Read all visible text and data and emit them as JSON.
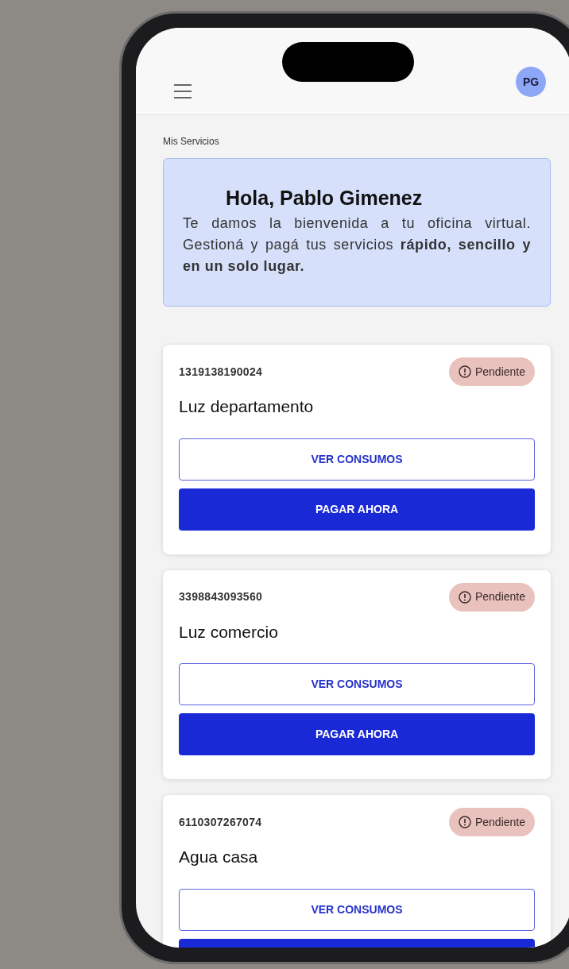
{
  "header": {
    "avatar_initials": "PG"
  },
  "section_title": "Mis Servicios",
  "welcome": {
    "title": "Hola, Pablo Gimenez",
    "text": "Te damos la bienvenida a tu oficina virtual. Gestioná y pagá tus servicios **rápido, sencillo y en un solo lugar.**"
  },
  "services": [
    {
      "number": "1319138190024",
      "name": "Luz departamento",
      "status": {
        "kind": "pending",
        "label": "Pendiente"
      },
      "buttons": [
        {
          "kind": "outline",
          "label": "VER CONSUMOS"
        },
        {
          "kind": "filled",
          "label": "PAGAR AHORA"
        }
      ]
    },
    {
      "number": "3398843093560",
      "name": "Luz comercio",
      "status": {
        "kind": "pending",
        "label": "Pendiente"
      },
      "buttons": [
        {
          "kind": "outline",
          "label": "VER CONSUMOS"
        },
        {
          "kind": "filled",
          "label": "PAGAR AHORA"
        }
      ]
    },
    {
      "number": "6110307267074",
      "name": "Agua casa",
      "status": {
        "kind": "pending",
        "label": "Pendiente"
      },
      "buttons": [
        {
          "kind": "outline",
          "label": "VER CONSUMOS"
        },
        {
          "kind": "filled"
        }
      ]
    }
  ]
}
